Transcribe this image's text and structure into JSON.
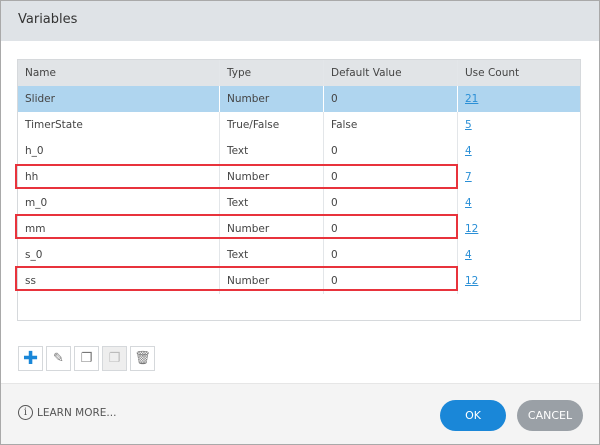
{
  "dialog": {
    "title": "Variables"
  },
  "table": {
    "columns": [
      "Name",
      "Type",
      "Default Value",
      "Use Count"
    ],
    "rows": [
      {
        "name": "Slider",
        "type": "Number",
        "default": "0",
        "count": "21"
      },
      {
        "name": "TimerState",
        "type": "True/False",
        "default": "False",
        "count": "5"
      },
      {
        "name": "h_0",
        "type": "Text",
        "default": "0",
        "count": "4"
      },
      {
        "name": "hh",
        "type": "Number",
        "default": "0",
        "count": "7"
      },
      {
        "name": "m_0",
        "type": "Text",
        "default": "0",
        "count": "4"
      },
      {
        "name": "mm",
        "type": "Number",
        "default": "0",
        "count": "12"
      },
      {
        "name": "s_0",
        "type": "Text",
        "default": "0",
        "count": "4"
      },
      {
        "name": "ss",
        "type": "Number",
        "default": "0",
        "count": "12"
      }
    ]
  },
  "footer": {
    "learn_more": "LEARN MORE...",
    "ok": "OK",
    "cancel": "CANCEL"
  },
  "colors": {
    "accent": "#1a87d8",
    "selected_row": "#afd5ef",
    "highlight": "#e8333c"
  }
}
